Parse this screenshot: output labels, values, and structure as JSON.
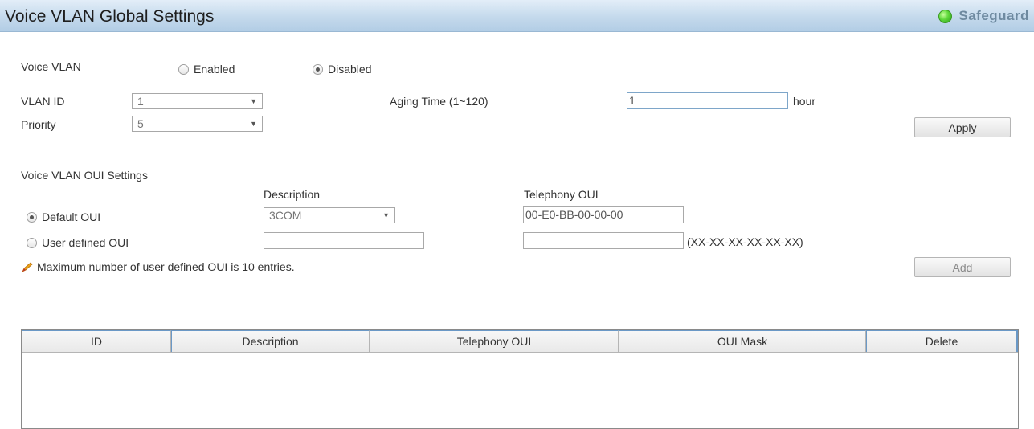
{
  "header": {
    "title": "Voice VLAN Global Settings",
    "safeguard_label": "Safeguard",
    "safeguard_color": "#47c12a"
  },
  "global": {
    "voice_vlan_label": "Voice VLAN",
    "enabled_label": "Enabled",
    "disabled_label": "Disabled",
    "voice_vlan_state": "Disabled",
    "vlan_id_label": "VLAN ID",
    "vlan_id_value": "1",
    "priority_label": "Priority",
    "priority_value": "5",
    "aging_time_label": "Aging Time (1~120)",
    "aging_time_value": "1",
    "aging_unit": "hour",
    "apply_label": "Apply"
  },
  "oui": {
    "section_title": "Voice VLAN OUI Settings",
    "description_header": "Description",
    "telephony_header": "Telephony OUI",
    "default_oui_label": "Default OUI",
    "default_description": "3COM",
    "default_telephony_oui": "00-E0-BB-00-00-00",
    "user_defined_label": "User defined OUI",
    "user_description": "",
    "user_telephony_oui": "",
    "format_hint": "(XX-XX-XX-XX-XX-XX)",
    "note": "Maximum number of user defined OUI is 10 entries.",
    "add_label": "Add",
    "selected": "Default OUI"
  },
  "table": {
    "columns": [
      "ID",
      "Description",
      "Telephony OUI",
      "OUI Mask",
      "Delete"
    ],
    "rows": []
  }
}
